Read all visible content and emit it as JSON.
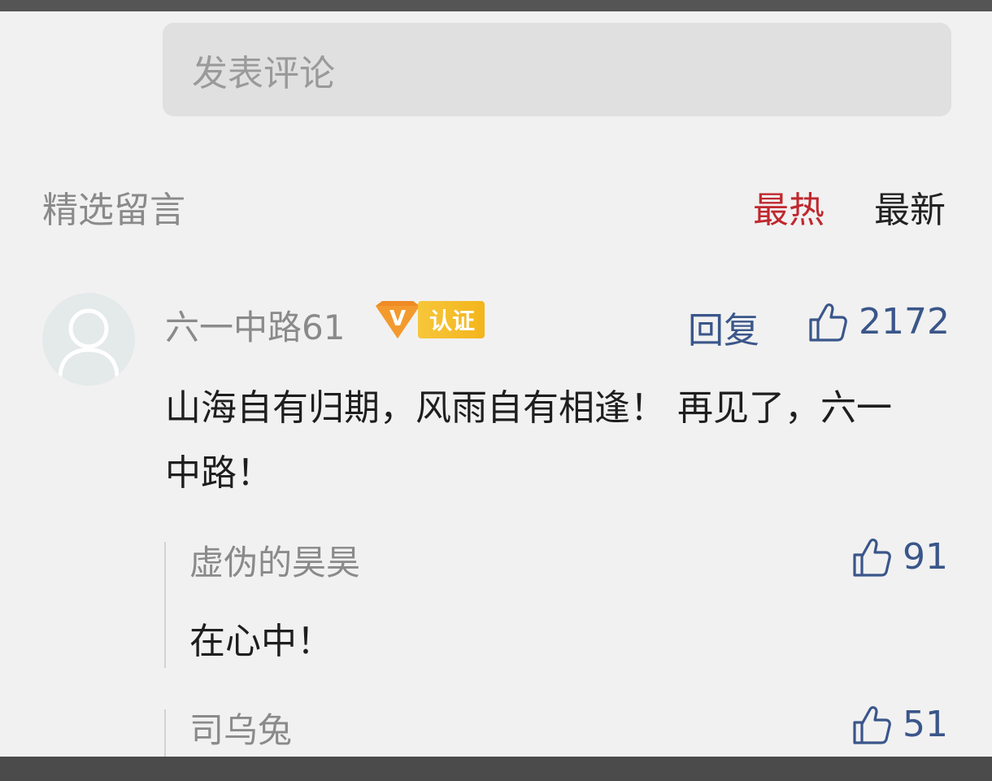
{
  "input": {
    "placeholder": "发表评论"
  },
  "section": {
    "title": "精选留言",
    "sort_hot": "最热",
    "sort_new": "最新"
  },
  "comment": {
    "author": "六一中路61",
    "badge_v": "V",
    "badge_text": "认证",
    "reply_label": "回复",
    "likes": "2172",
    "text": "山海自有归期，风雨自有相逢！ 再见了，六一中路！"
  },
  "replies": [
    {
      "author": "虚伪的昊昊",
      "likes": "91",
      "text": "在心中！"
    },
    {
      "author": "司乌兔",
      "likes": "51"
    }
  ],
  "colors": {
    "accent_red": "#c0282e",
    "link_blue": "#3a568a",
    "badge_gold": "#f3b51c"
  }
}
